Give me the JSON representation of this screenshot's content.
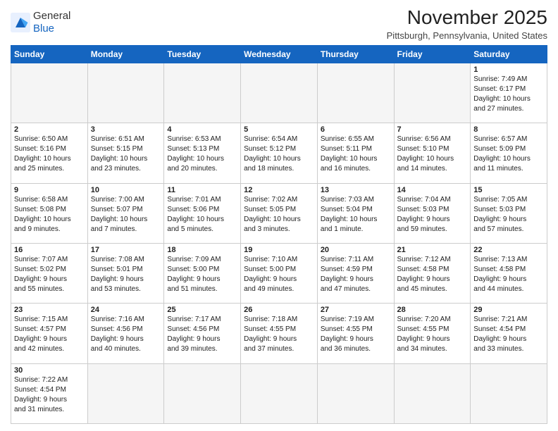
{
  "header": {
    "logo_general": "General",
    "logo_blue": "Blue",
    "month_title": "November 2025",
    "location": "Pittsburgh, Pennsylvania, United States"
  },
  "days_of_week": [
    "Sunday",
    "Monday",
    "Tuesday",
    "Wednesday",
    "Thursday",
    "Friday",
    "Saturday"
  ],
  "weeks": [
    [
      {
        "day": "",
        "info": ""
      },
      {
        "day": "",
        "info": ""
      },
      {
        "day": "",
        "info": ""
      },
      {
        "day": "",
        "info": ""
      },
      {
        "day": "",
        "info": ""
      },
      {
        "day": "",
        "info": ""
      },
      {
        "day": "1",
        "info": "Sunrise: 7:49 AM\nSunset: 6:17 PM\nDaylight: 10 hours\nand 27 minutes."
      }
    ],
    [
      {
        "day": "2",
        "info": "Sunrise: 6:50 AM\nSunset: 5:16 PM\nDaylight: 10 hours\nand 25 minutes."
      },
      {
        "day": "3",
        "info": "Sunrise: 6:51 AM\nSunset: 5:15 PM\nDaylight: 10 hours\nand 23 minutes."
      },
      {
        "day": "4",
        "info": "Sunrise: 6:53 AM\nSunset: 5:13 PM\nDaylight: 10 hours\nand 20 minutes."
      },
      {
        "day": "5",
        "info": "Sunrise: 6:54 AM\nSunset: 5:12 PM\nDaylight: 10 hours\nand 18 minutes."
      },
      {
        "day": "6",
        "info": "Sunrise: 6:55 AM\nSunset: 5:11 PM\nDaylight: 10 hours\nand 16 minutes."
      },
      {
        "day": "7",
        "info": "Sunrise: 6:56 AM\nSunset: 5:10 PM\nDaylight: 10 hours\nand 14 minutes."
      },
      {
        "day": "8",
        "info": "Sunrise: 6:57 AM\nSunset: 5:09 PM\nDaylight: 10 hours\nand 11 minutes."
      }
    ],
    [
      {
        "day": "9",
        "info": "Sunrise: 6:58 AM\nSunset: 5:08 PM\nDaylight: 10 hours\nand 9 minutes."
      },
      {
        "day": "10",
        "info": "Sunrise: 7:00 AM\nSunset: 5:07 PM\nDaylight: 10 hours\nand 7 minutes."
      },
      {
        "day": "11",
        "info": "Sunrise: 7:01 AM\nSunset: 5:06 PM\nDaylight: 10 hours\nand 5 minutes."
      },
      {
        "day": "12",
        "info": "Sunrise: 7:02 AM\nSunset: 5:05 PM\nDaylight: 10 hours\nand 3 minutes."
      },
      {
        "day": "13",
        "info": "Sunrise: 7:03 AM\nSunset: 5:04 PM\nDaylight: 10 hours\nand 1 minute."
      },
      {
        "day": "14",
        "info": "Sunrise: 7:04 AM\nSunset: 5:03 PM\nDaylight: 9 hours\nand 59 minutes."
      },
      {
        "day": "15",
        "info": "Sunrise: 7:05 AM\nSunset: 5:03 PM\nDaylight: 9 hours\nand 57 minutes."
      }
    ],
    [
      {
        "day": "16",
        "info": "Sunrise: 7:07 AM\nSunset: 5:02 PM\nDaylight: 9 hours\nand 55 minutes."
      },
      {
        "day": "17",
        "info": "Sunrise: 7:08 AM\nSunset: 5:01 PM\nDaylight: 9 hours\nand 53 minutes."
      },
      {
        "day": "18",
        "info": "Sunrise: 7:09 AM\nSunset: 5:00 PM\nDaylight: 9 hours\nand 51 minutes."
      },
      {
        "day": "19",
        "info": "Sunrise: 7:10 AM\nSunset: 5:00 PM\nDaylight: 9 hours\nand 49 minutes."
      },
      {
        "day": "20",
        "info": "Sunrise: 7:11 AM\nSunset: 4:59 PM\nDaylight: 9 hours\nand 47 minutes."
      },
      {
        "day": "21",
        "info": "Sunrise: 7:12 AM\nSunset: 4:58 PM\nDaylight: 9 hours\nand 45 minutes."
      },
      {
        "day": "22",
        "info": "Sunrise: 7:13 AM\nSunset: 4:58 PM\nDaylight: 9 hours\nand 44 minutes."
      }
    ],
    [
      {
        "day": "23",
        "info": "Sunrise: 7:15 AM\nSunset: 4:57 PM\nDaylight: 9 hours\nand 42 minutes."
      },
      {
        "day": "24",
        "info": "Sunrise: 7:16 AM\nSunset: 4:56 PM\nDaylight: 9 hours\nand 40 minutes."
      },
      {
        "day": "25",
        "info": "Sunrise: 7:17 AM\nSunset: 4:56 PM\nDaylight: 9 hours\nand 39 minutes."
      },
      {
        "day": "26",
        "info": "Sunrise: 7:18 AM\nSunset: 4:55 PM\nDaylight: 9 hours\nand 37 minutes."
      },
      {
        "day": "27",
        "info": "Sunrise: 7:19 AM\nSunset: 4:55 PM\nDaylight: 9 hours\nand 36 minutes."
      },
      {
        "day": "28",
        "info": "Sunrise: 7:20 AM\nSunset: 4:55 PM\nDaylight: 9 hours\nand 34 minutes."
      },
      {
        "day": "29",
        "info": "Sunrise: 7:21 AM\nSunset: 4:54 PM\nDaylight: 9 hours\nand 33 minutes."
      }
    ],
    [
      {
        "day": "30",
        "info": "Sunrise: 7:22 AM\nSunset: 4:54 PM\nDaylight: 9 hours\nand 31 minutes."
      },
      {
        "day": "",
        "info": ""
      },
      {
        "day": "",
        "info": ""
      },
      {
        "day": "",
        "info": ""
      },
      {
        "day": "",
        "info": ""
      },
      {
        "day": "",
        "info": ""
      },
      {
        "day": "",
        "info": ""
      }
    ]
  ]
}
